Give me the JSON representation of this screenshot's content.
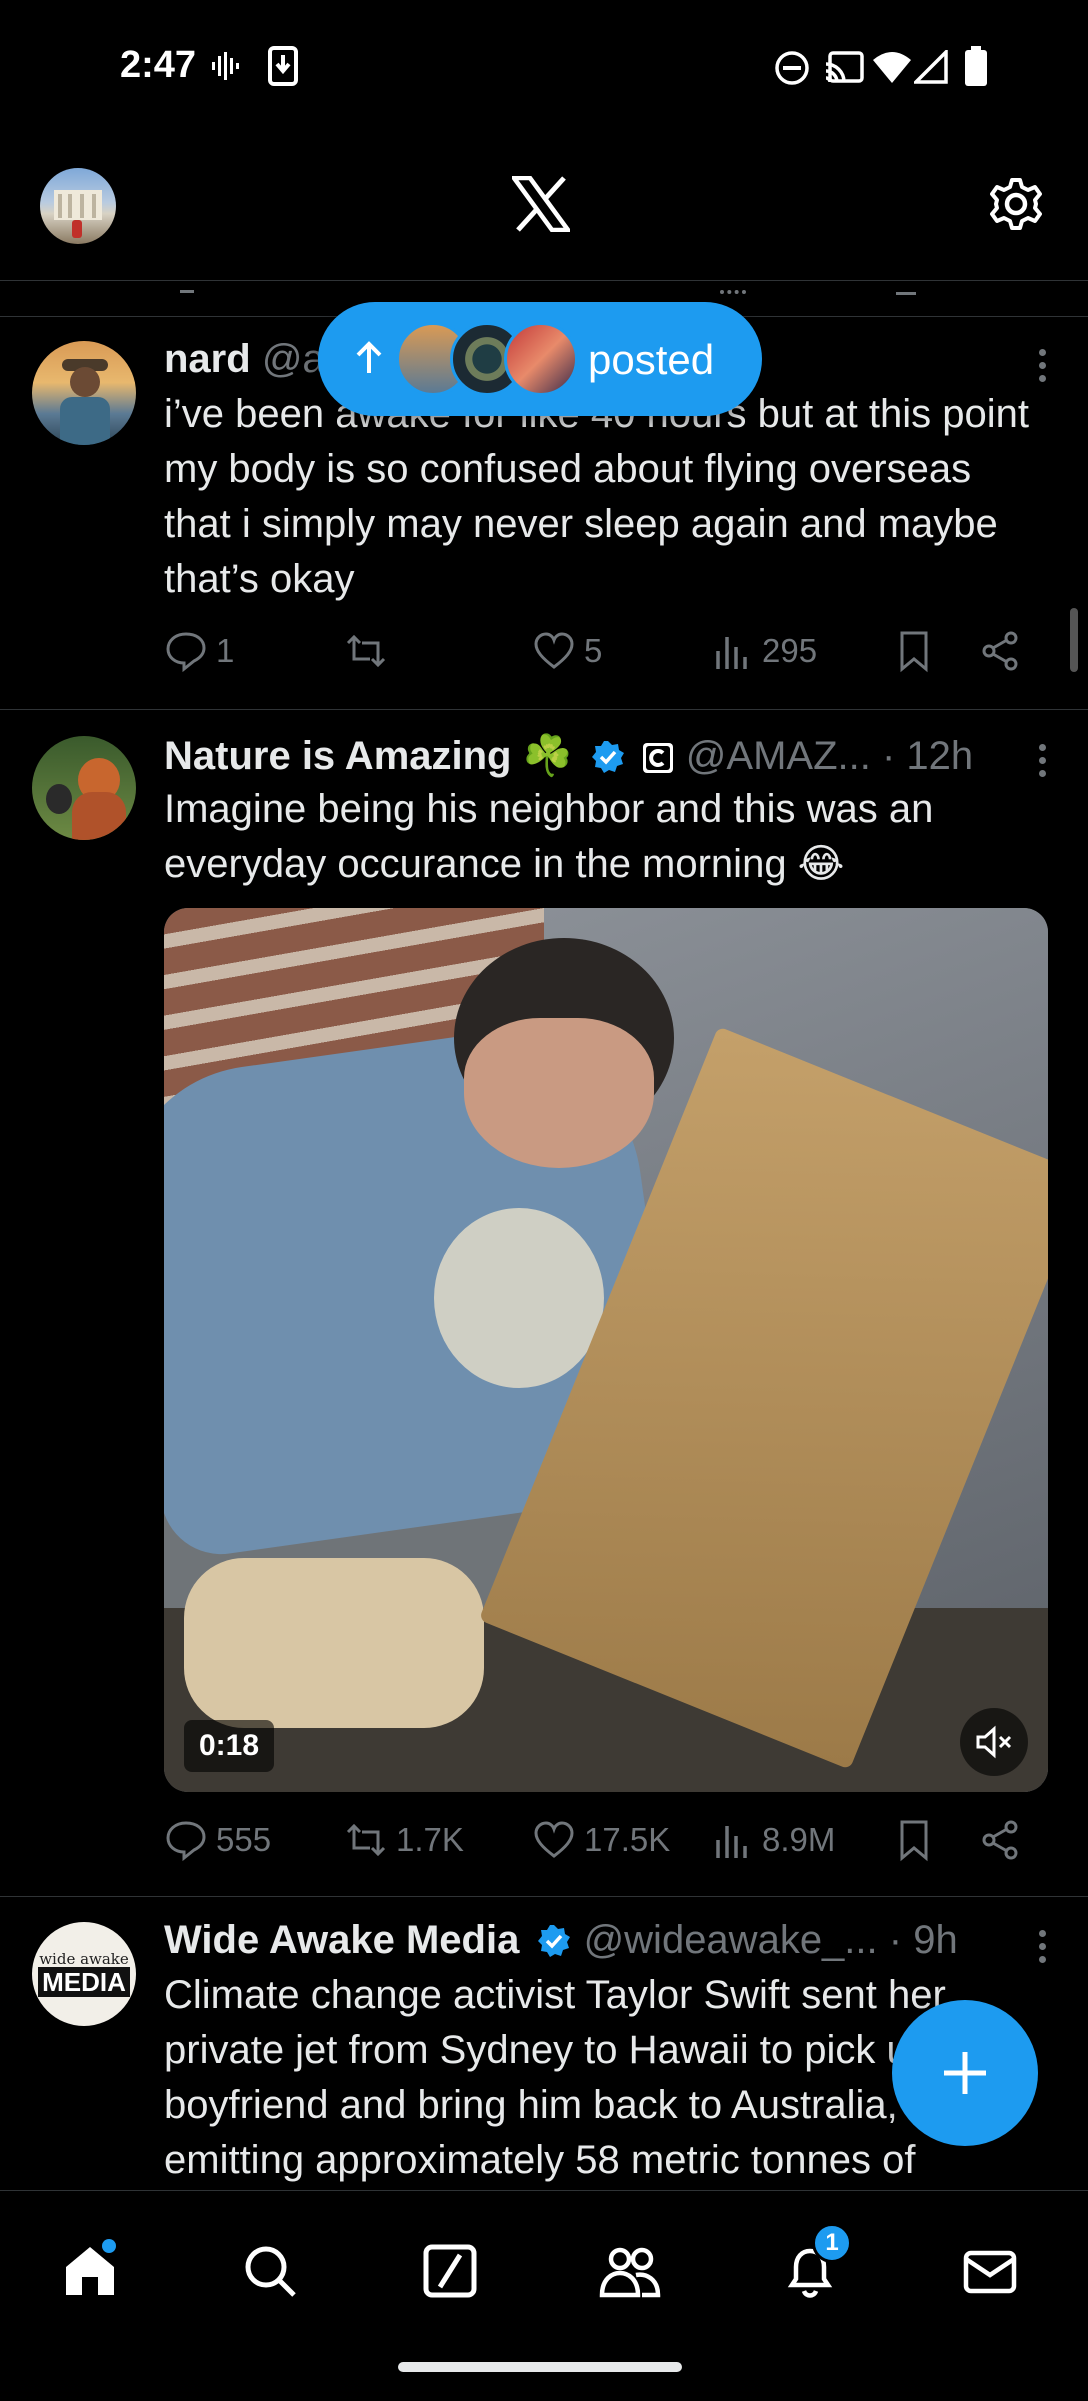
{
  "status_bar": {
    "time": "2:47"
  },
  "colors": {
    "accent": "#1d9bf0",
    "background": "#000000",
    "muted": "#71767b",
    "text": "#e7e9ea"
  },
  "new_posts_pill": {
    "label": "posted"
  },
  "tweets": [
    {
      "name": "nard",
      "handle": "@a",
      "text": "i’ve been awake for like 40 hours but at this point my body is so confused about flying overseas that i simply may never sleep again and maybe that’s okay",
      "replies": "1",
      "retweets": "",
      "likes": "5",
      "views": "295"
    },
    {
      "name": "Nature is Amazing ☘️",
      "handle": "@AMAZ...",
      "time": "· 12h",
      "text": "Imagine being his neighbor and this was an everyday occurance in the morning 😂",
      "video_duration": "0:18",
      "replies": "555",
      "retweets": "1.7K",
      "likes": "17.5K",
      "views": "8.9M"
    },
    {
      "name": "Wide Awake Media",
      "handle": "@wideawake_...",
      "time": "· 9h",
      "text": "Climate change activist Taylor Swift sent her private jet from Sydney to Hawaii to pick up her boyfriend and bring him back to Australia, emitting approximately 58 metric tonnes of",
      "avatar_text_top": "wide awake",
      "avatar_text_bottom": "MEDIA"
    }
  ],
  "bottom_nav": {
    "items": [
      "home-icon",
      "search-icon",
      "grok-icon",
      "communities-icon",
      "notifications-icon",
      "messages-icon"
    ],
    "notification_count": "1"
  }
}
